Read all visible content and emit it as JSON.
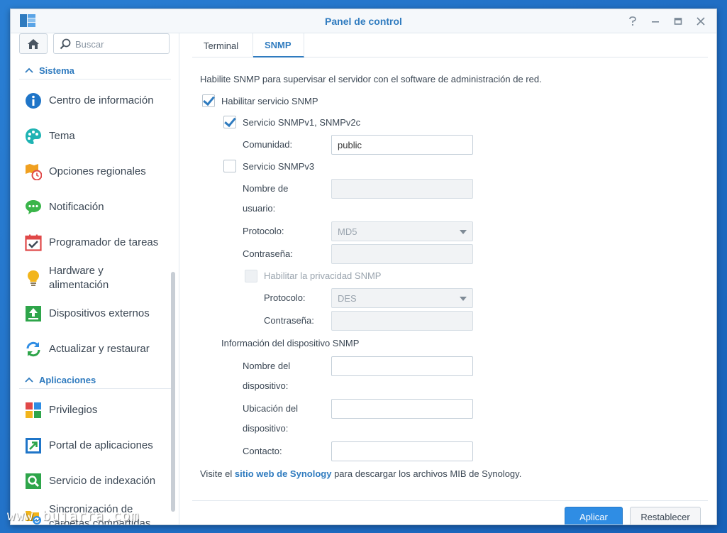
{
  "window": {
    "title": "Panel de control"
  },
  "sidebar": {
    "search_placeholder": "Buscar",
    "sections": [
      {
        "label": "Sistema",
        "items": [
          {
            "label": "Centro de información",
            "icon": "info-icon"
          },
          {
            "label": "Tema",
            "icon": "palette-icon"
          },
          {
            "label": "Opciones regionales",
            "icon": "regional-clock-icon"
          },
          {
            "label": "Notificación",
            "icon": "chat-bubble-icon"
          },
          {
            "label": "Programador de tareas",
            "icon": "calendar-check-icon"
          },
          {
            "label": "Hardware y",
            "label2": "alimentación",
            "icon": "lightbulb-icon"
          },
          {
            "label": "Dispositivos externos",
            "icon": "external-device-icon"
          },
          {
            "label": "Actualizar y restaurar",
            "icon": "refresh-icon"
          }
        ]
      },
      {
        "label": "Aplicaciones",
        "items": [
          {
            "label": "Privilegios",
            "icon": "privileges-icon"
          },
          {
            "label": "Portal de aplicaciones",
            "icon": "portal-arrow-icon"
          },
          {
            "label": "Servicio de indexación",
            "icon": "index-search-icon"
          },
          {
            "label": "Sincronización de",
            "label2": "carpetas compartidas",
            "icon": "folder-sync-icon"
          }
        ]
      }
    ]
  },
  "tabs": [
    {
      "label": "Terminal",
      "active": false
    },
    {
      "label": "SNMP",
      "active": true
    }
  ],
  "snmp": {
    "intro": "Habilite SNMP para supervisar el servidor con el software de administración de red.",
    "enable_label": "Habilitar servicio SNMP",
    "enable_checked": true,
    "v1v2c_label": "Servicio SNMPv1, SNMPv2c",
    "v1v2c_checked": true,
    "community_label": "Comunidad:",
    "community_value": "public",
    "v3_label": "Servicio SNMPv3",
    "v3_checked": false,
    "username_label_1": "Nombre de",
    "username_label_2": "usuario:",
    "protocol_label": "Protocolo:",
    "protocol_value": "MD5",
    "password_label": "Contraseña:",
    "privacy_label": "Habilitar la privacidad SNMP",
    "privacy_checked": false,
    "privacy_protocol_label": "Protocolo:",
    "privacy_protocol_value": "DES",
    "privacy_password_label": "Contraseña:",
    "device_info_header": "Información del dispositivo SNMP",
    "device_name_label_1": "Nombre del",
    "device_name_label_2": "dispositivo:",
    "device_location_label_1": "Ubicación del",
    "device_location_label_2": "dispositivo:",
    "contact_label": "Contacto:",
    "footer_prefix": "Visite el",
    "footer_link": "sitio web de Synology",
    "footer_suffix": "para descargar los archivos MIB de Synology."
  },
  "buttons": {
    "apply": "Aplicar",
    "reset": "Restablecer"
  },
  "watermark": "www.bujarra.com",
  "colors": {
    "accent": "#2f7bbf",
    "primary_button": "#2f8de4",
    "desktop": "#1e6ec8"
  }
}
